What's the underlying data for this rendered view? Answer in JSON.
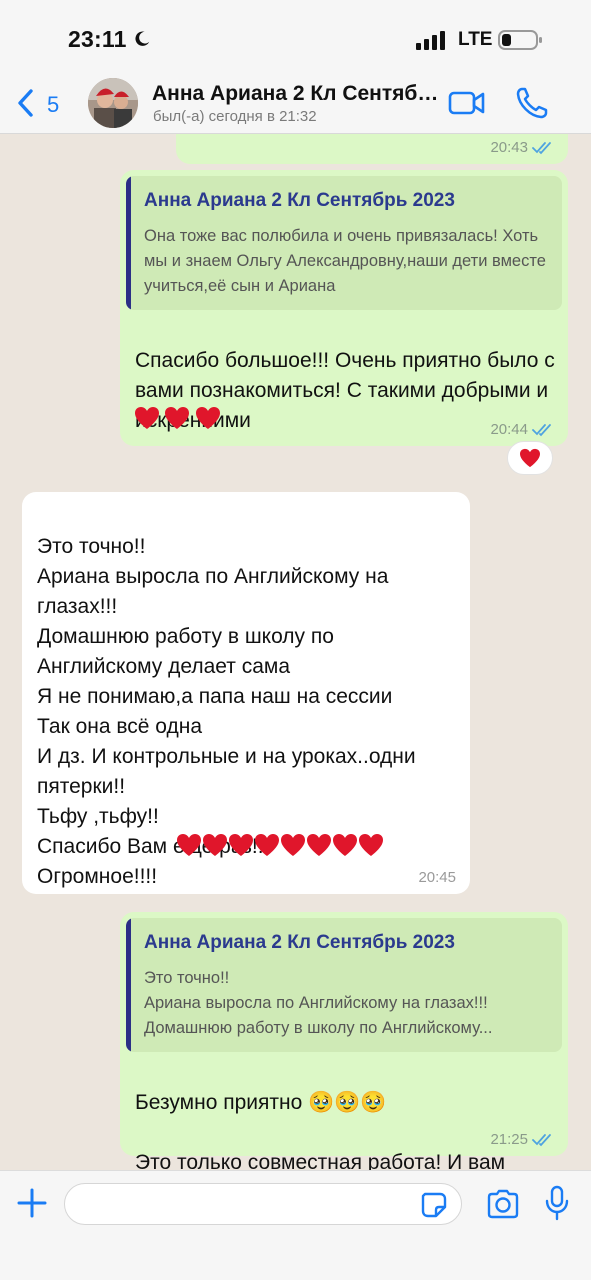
{
  "status_bar": {
    "time": "23:11",
    "network": "LTE"
  },
  "header": {
    "back_count": "5",
    "contact_name": "Анна Ариана 2 Кл Сентябрь 2023",
    "last_seen": "был(-а) сегодня в 21:32"
  },
  "colors": {
    "accent": "#1a7cf4",
    "outgoing_bubble": "#dcf8c6",
    "incoming_bubble": "#ffffff",
    "quote_bar": "#2b2f86",
    "heart": "#e0162b"
  },
  "messages": [
    {
      "direction": "out",
      "time": "20:43",
      "read": true
    },
    {
      "direction": "out",
      "quote_author": "Анна Ариана 2 Кл Сентябрь 2023",
      "quote_text": "Она тоже вас полюбила и очень привязалась! Хоть мы и знаем Ольгу Александровну,наши дети вместе учиться,её сын и Ариана",
      "text": "Спасибо большое!!! Очень приятно было с вами познакомиться! С такими добрыми и искренними",
      "hearts": 3,
      "time": "20:44",
      "read": true,
      "reaction": "heart"
    },
    {
      "direction": "in",
      "text": "Это точно!!\nАриана выросла по Английскому на глазах!!!\nДомашнюю работу в школу по Английскому делает сама\nЯ не понимаю,а папа наш на сессии\nТак она всё одна\nИ дз. И контрольные и на уроках..одни пятерки!!\nТьфу ,тьфу!!\nСпасибо Вам еще раз!!!\nОгромное!!!!",
      "hearts": 8,
      "time": "20:45"
    },
    {
      "direction": "out",
      "quote_author": "Анна Ариана 2 Кл Сентябрь 2023",
      "quote_text": "Это точно!!\nАриана выросла по Английскому на глазах!!!\nДомашнюю работу в школу по Английскому...",
      "text_line1": "Безумно приятно",
      "text_line1_emoji": "🥹🥹🥹",
      "text_line2": "Это только совместная работа! И вам спасибо большое",
      "text_line2_emoji": "🙏🏻",
      "time": "21:25",
      "read": true
    }
  ],
  "composer": {
    "placeholder": ""
  },
  "icons": [
    "back-chevron-icon",
    "video-call-icon",
    "phone-icon",
    "plus-icon",
    "sticker-icon",
    "camera-icon",
    "microphone-icon",
    "double-check-icon",
    "heart-icon"
  ]
}
